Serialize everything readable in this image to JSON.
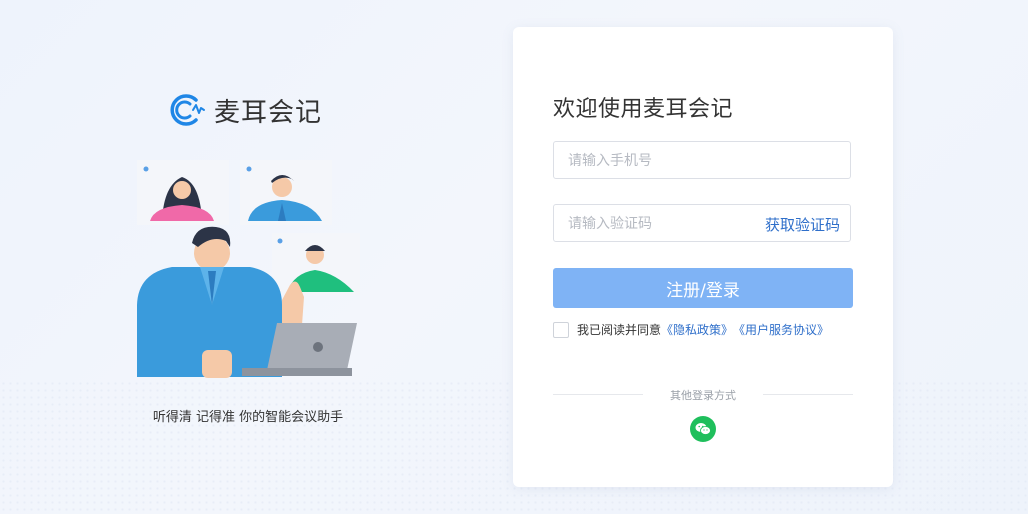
{
  "brand": {
    "name": "麦耳会记",
    "tagline": "听得清 记得准 你的智能会议助手"
  },
  "login": {
    "welcome": "欢迎使用麦耳会记",
    "phone_placeholder": "请输入手机号",
    "code_placeholder": "请输入验证码",
    "get_code_label": "获取验证码",
    "submit_label": "注册/登录",
    "agree_text": "我已阅读并同意",
    "privacy_link": "《隐私政策》",
    "service_link": "《用户服务协议》",
    "other_login_label": "其他登录方式",
    "other_login_icon": "wechat-icon"
  },
  "colors": {
    "accent": "#2f6fca",
    "button_bg": "#7fb3f5",
    "wechat_green": "#1fbf5c",
    "brand_blue": "#1f86e6"
  }
}
